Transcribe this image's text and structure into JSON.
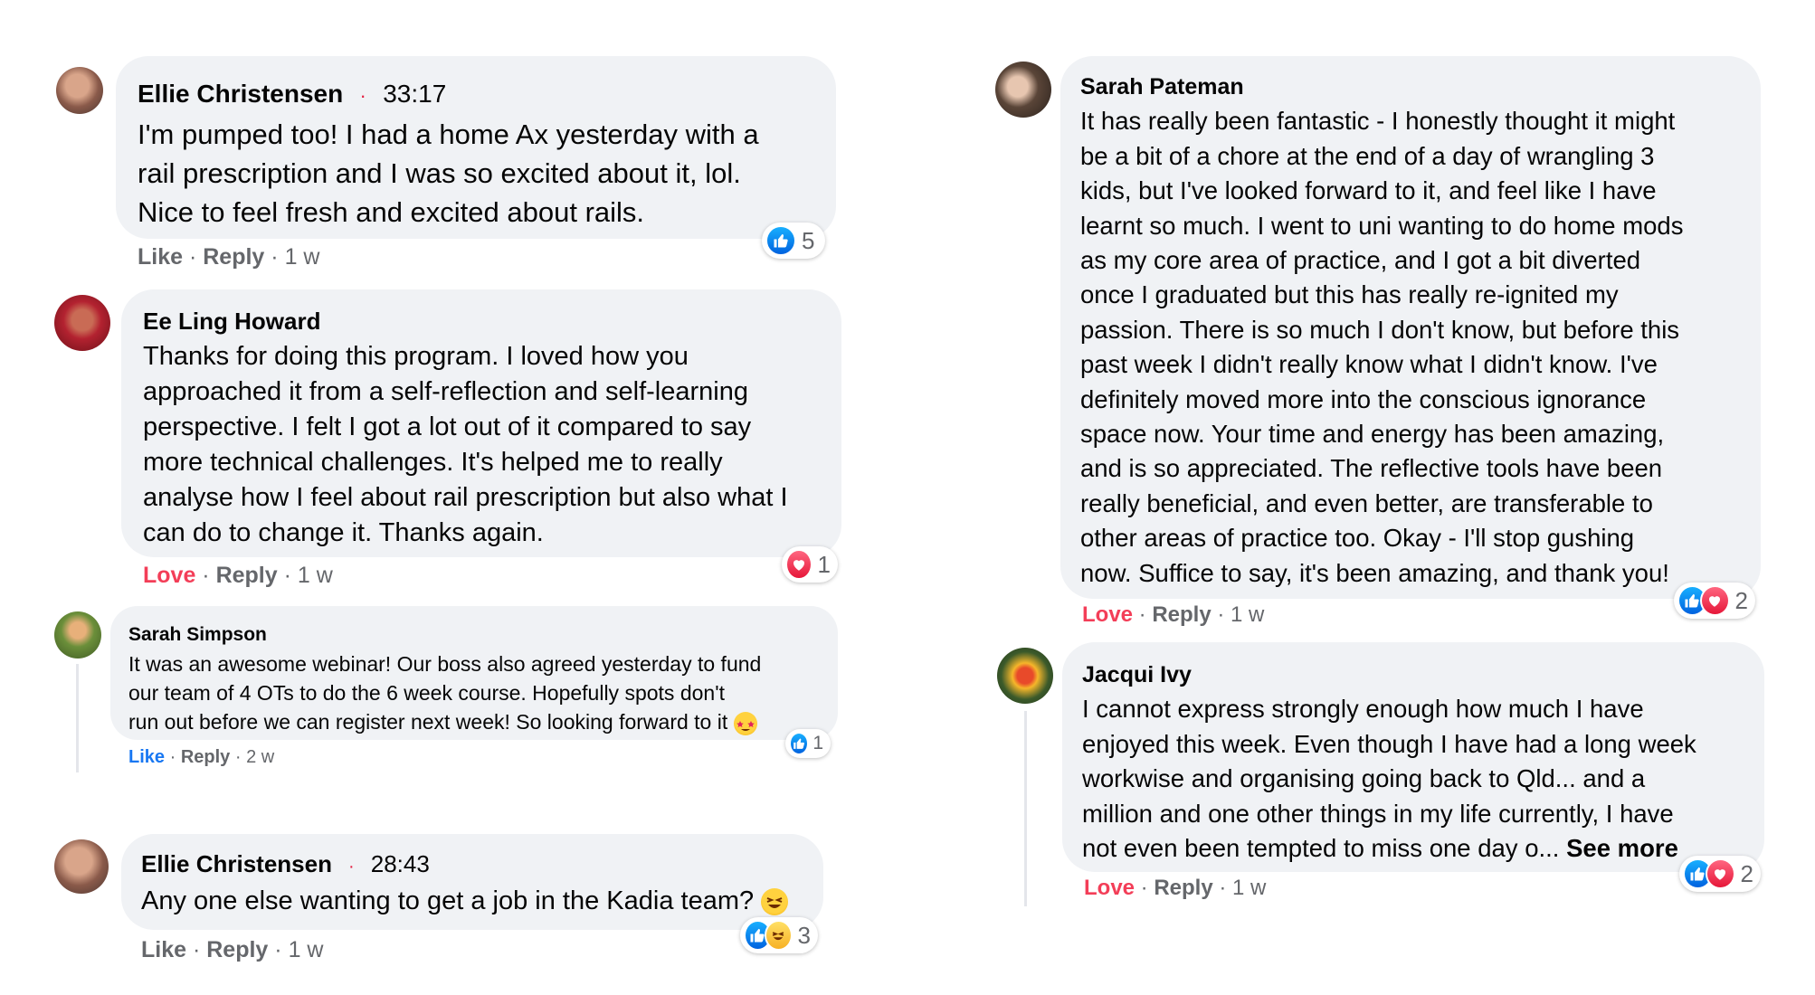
{
  "comments": [
    {
      "author": "Ellie Christensen",
      "sep": "·",
      "timestamp": "33:17",
      "text": "I'm pumped too! I had a home Ax yesterday with a\nrail prescription and I was so excited about it, lol.\nNice to feel fresh and excited about rails.",
      "action1": "Like",
      "dot1": " · ",
      "reply": "Reply",
      "dot2": " · ",
      "ago": "1 w",
      "reaction_count": "5",
      "reactions": [
        "like"
      ]
    },
    {
      "author": "Ee Ling Howard",
      "text": "Thanks for doing this program. I loved how you\napproached it from a self-reflection and self-learning\nperspective. I felt I got a lot out of it compared to say\nmore technical challenges. It's helped me to really\nanalyse how I feel about rail prescription but also what I\ncan do to change it. Thanks again.",
      "action1": "Love",
      "dot1": " · ",
      "reply": "Reply",
      "dot2": " · ",
      "ago": "1 w",
      "reaction_count": "1",
      "reactions": [
        "love"
      ]
    },
    {
      "author": "Sarah Simpson",
      "text": "It was an awesome webinar! Our boss also agreed yesterday to fund\nour team of 4 OTs to do the 6 week course. Hopefully spots don't\nrun out before we can register next week! So looking forward to it",
      "emoji": "star-struck-emoji",
      "action1": "Like",
      "dot1": " · ",
      "reply": "Reply",
      "dot2": " · ",
      "ago": "2 w",
      "reaction_count": "1",
      "reactions": [
        "like"
      ]
    },
    {
      "author": "Ellie Christensen",
      "sep": "·",
      "timestamp": "28:43",
      "text": "Any one else wanting to get a job in the Kadia team?",
      "emoji": "laughing-emoji",
      "action1": "Like",
      "dot1": " · ",
      "reply": "Reply",
      "dot2": " · ",
      "ago": "1 w",
      "reaction_count": "3",
      "reactions": [
        "like",
        "haha"
      ]
    },
    {
      "author": "Sarah Pateman",
      "text": "It has really been fantastic - I honestly thought it might\nbe a bit of a chore at the end of a day of wrangling 3\nkids, but I've looked forward to it, and feel like I have\nlearnt so much. I went to uni wanting to do home mods\nas my core area of practice, and I got a bit diverted\nonce I graduated but this has really re-ignited my\npassion. There is so much I don't know, but before this\npast week I didn't really know what I didn't know. I've\ndefinitely moved more into the conscious ignorance\nspace now. Your time and energy has been amazing,\nand is so appreciated. The reflective tools have been\nreally beneficial, and even better, are transferable to\nother areas of practice too. Okay - I'll stop gushing\nnow. Suffice to say, it's been amazing, and thank you!",
      "action1": "Love",
      "dot1": " · ",
      "reply": "Reply",
      "dot2": " · ",
      "ago": "1 w",
      "reaction_count": "2",
      "reactions": [
        "like",
        "love"
      ]
    },
    {
      "author": "Jacqui Ivy",
      "text": "I cannot express strongly enough how much I have\nenjoyed this week. Even though I have had a long week\nworkwise and organising going back to Qld... and a\nmillion and one other things in my life currently, I have\nnot even been tempted to miss one day o... ",
      "see_more": "See more",
      "action1": "Love",
      "dot1": " · ",
      "reply": "Reply",
      "dot2": " · ",
      "ago": "1 w",
      "reaction_count": "2",
      "reactions": [
        "like",
        "love"
      ]
    }
  ]
}
